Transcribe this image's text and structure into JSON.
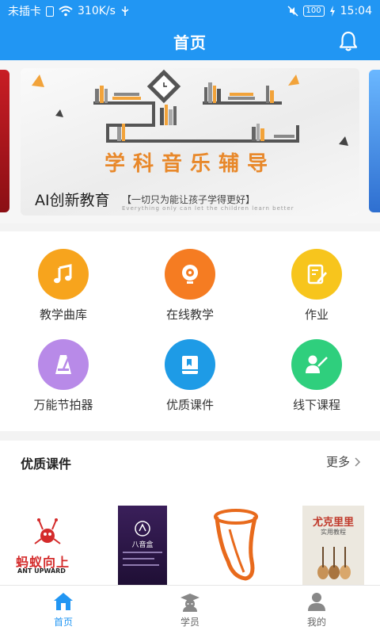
{
  "status_bar": {
    "carrier": "未插卡",
    "speed": "310K/s",
    "battery": "100",
    "time": "15:04"
  },
  "header": {
    "title": "首页",
    "bell_icon": "bell-icon"
  },
  "banner": {
    "headline": "学科音乐辅导",
    "title": "AI创新教育",
    "slogan": "【一切只为能让孩子学得更好】",
    "slogan_en": "Everything only can let the children learn better"
  },
  "functions": [
    {
      "label": "教学曲库",
      "icon": "music-note-icon",
      "color": "#f7a41d"
    },
    {
      "label": "在线教学",
      "icon": "webcam-icon",
      "color": "#f57c22"
    },
    {
      "label": "作业",
      "icon": "edit-note-icon",
      "color": "#f7c51d"
    },
    {
      "label": "万能节拍器",
      "icon": "metronome-icon",
      "color": "#b88ae8"
    },
    {
      "label": "优质课件",
      "icon": "book-icon",
      "color": "#1e9be6"
    },
    {
      "label": "线下课程",
      "icon": "teacher-icon",
      "color": "#2fcf7d"
    }
  ],
  "courseware": {
    "title": "优质课件",
    "more": "更多",
    "cards": [
      {
        "name": "ant-upward-card",
        "text": "蚂蚁向上",
        "subtext": "ANT UPWARD"
      },
      {
        "name": "choir-card",
        "text": "八音盒"
      },
      {
        "name": "trumpet-card",
        "text": ""
      },
      {
        "name": "ukulele-card",
        "text": "尤克里里",
        "subtext": "实用教程"
      }
    ]
  },
  "bottom_nav": [
    {
      "label": "首页",
      "icon": "home-icon",
      "active": true
    },
    {
      "label": "学员",
      "icon": "student-icon",
      "active": false
    },
    {
      "label": "我的",
      "icon": "profile-icon",
      "active": false
    }
  ],
  "colors": {
    "primary": "#2196f3",
    "background": "#f3f3f3"
  }
}
